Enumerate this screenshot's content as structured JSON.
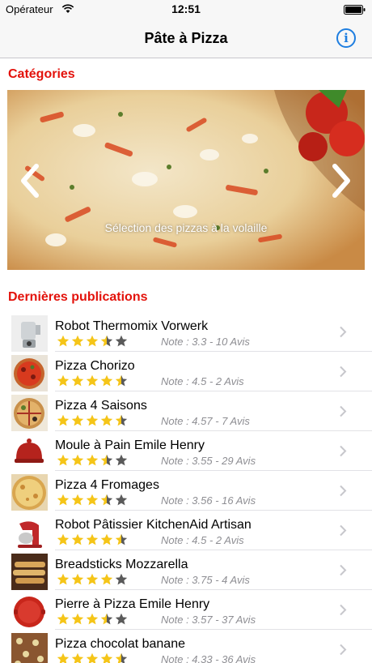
{
  "status_bar": {
    "carrier": "Opérateur",
    "time": "12:51",
    "wifi_icon": "wifi-icon",
    "battery_icon": "battery-icon"
  },
  "nav": {
    "title": "Pâte à Pizza",
    "info_icon": "info-icon",
    "info_glyph": "i"
  },
  "colors": {
    "accent_red": "#e3120b",
    "ios_blue": "#1e7ee0",
    "star_gold": "#f5c518",
    "star_gray": "#5a5a5a"
  },
  "categories": {
    "header": "Catégories",
    "slide_caption": "Sélection des pizzas à la volaille",
    "prev_icon": "chevron-left-icon",
    "next_icon": "chevron-right-icon"
  },
  "publications": {
    "header": "Dernières publications",
    "items": [
      {
        "title": "Robot Thermomix Vorwerk",
        "note": "Note : 3.3 - 10 Avis",
        "rating": 3.3,
        "thumb": "thermomix"
      },
      {
        "title": "Pizza Chorizo",
        "note": "Note : 4.5 - 2 Avis",
        "rating": 4.5,
        "thumb": "pizza-red"
      },
      {
        "title": "Pizza 4 Saisons",
        "note": "Note : 4.57 - 7 Avis",
        "rating": 4.57,
        "thumb": "pizza-mixed"
      },
      {
        "title": "Moule à Pain Emile Henry",
        "note": "Note : 3.55 - 29 Avis",
        "rating": 3.55,
        "thumb": "bread-dome"
      },
      {
        "title": "Pizza 4 Fromages",
        "note": "Note : 3.56 - 16 Avis",
        "rating": 3.56,
        "thumb": "pizza-cheese"
      },
      {
        "title": "Robot Pâtissier KitchenAid Artisan",
        "note": "Note : 4.5 - 2 Avis",
        "rating": 4.5,
        "thumb": "kitchenaid"
      },
      {
        "title": "Breadsticks Mozzarella",
        "note": "Note : 3.75 - 4 Avis",
        "rating": 3.75,
        "thumb": "breadsticks"
      },
      {
        "title": "Pierre à Pizza Emile Henry",
        "note": "Note : 3.57 - 37 Avis",
        "rating": 3.57,
        "thumb": "pizza-stone"
      },
      {
        "title": "Pizza chocolat banane",
        "note": "Note : 4.33 - 36 Avis",
        "rating": 4.33,
        "thumb": "pizza-choco"
      }
    ]
  }
}
